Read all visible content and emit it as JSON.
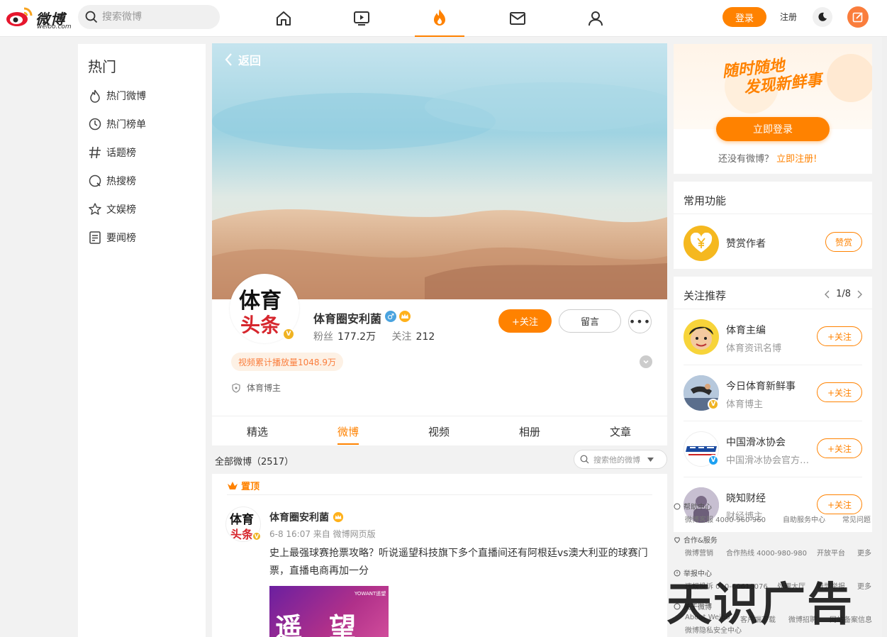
{
  "nav": {
    "logo_text": "微博",
    "logo_sub": "weibo.com",
    "search_placeholder": "搜索微博",
    "login": "登录",
    "register": "注册"
  },
  "sidebar": {
    "title": "热门",
    "items": [
      {
        "label": "热门微博",
        "icon": "fire-icon"
      },
      {
        "label": "热门榜单",
        "icon": "clock-icon"
      },
      {
        "label": "话题榜",
        "icon": "hash-icon"
      },
      {
        "label": "热搜榜",
        "icon": "search-ring-icon"
      },
      {
        "label": "文娱榜",
        "icon": "star-icon"
      },
      {
        "label": "要闻榜",
        "icon": "document-icon"
      }
    ]
  },
  "profile": {
    "back": "返回",
    "avatar_line1": "体育",
    "avatar_line2": "头条",
    "name": "体育圈安利菌",
    "gender_symbol": "♂",
    "fans_label": "粉丝",
    "fans_value": "177.2万",
    "following_label": "关注",
    "following_value": "212",
    "follow_btn": "+关注",
    "message_btn": "留言",
    "more_btn": "•••",
    "play_badge": "视频累计播放量1048.9万",
    "blogger_tag": "体育博主"
  },
  "tabs": [
    "精选",
    "微博",
    "视频",
    "相册",
    "文章"
  ],
  "active_tab": 1,
  "feed": {
    "all_label": "全部微博（2517）",
    "search_placeholder": "搜索他的微博",
    "pinned": "置顶",
    "post": {
      "author": "体育圈安利菌",
      "meta": "6-8 16:07 来自 微博网页版",
      "text": "史上最强球赛抢票攻略？听说遥望科技旗下多个直播间还有阿根廷vs澳大利亚的球赛门票，直播电商再加一分",
      "image_big_text": "遥望",
      "image_brand": "YOWANT遥望"
    }
  },
  "promo": {
    "slogan_line1": "随时随地",
    "slogan_line2": "发现新鲜事",
    "login_btn": "立即登录",
    "no_account": "还没有微博？",
    "register_link": "立即注册!"
  },
  "common": {
    "title": "常用功能",
    "reward_label": "赞赏作者",
    "reward_btn": "赞赏"
  },
  "recommend": {
    "title": "关注推荐",
    "page": "1/8",
    "follow_btn": "+关注",
    "items": [
      {
        "name": "体育主编",
        "desc": "体育资讯名博"
      },
      {
        "name": "今日体育新鲜事",
        "desc": "体育博主"
      },
      {
        "name": "中国滑冰协会",
        "desc": "中国滑冰协会官方…"
      },
      {
        "name": "晓知财经",
        "desc": "财经博主"
      }
    ]
  },
  "footer": {
    "help": {
      "title": "帮助中心",
      "links": [
        "微博客服 4000-960-960",
        "自助服务中心",
        "常见问题"
      ]
    },
    "coop": {
      "title": "合作&服务",
      "links": [
        "微博营销",
        "合作热线 4000-980-980",
        "开放平台",
        "更多"
      ]
    },
    "report": {
      "title": "举报中心",
      "links": [
        "违规投诉 010-60618076",
        "处理大厅",
        "舞弊举报",
        "更多"
      ]
    },
    "about": {
      "title": "关于微博",
      "links": [
        "About Weibo",
        "客户端下载",
        "微博招聘",
        "网站备案信息",
        "微博隐私安全中心"
      ]
    }
  },
  "watermark": "天识广告",
  "colors": {
    "accent": "#ff8200",
    "compose": "#fa7d3c",
    "verified": "#f0b322"
  }
}
